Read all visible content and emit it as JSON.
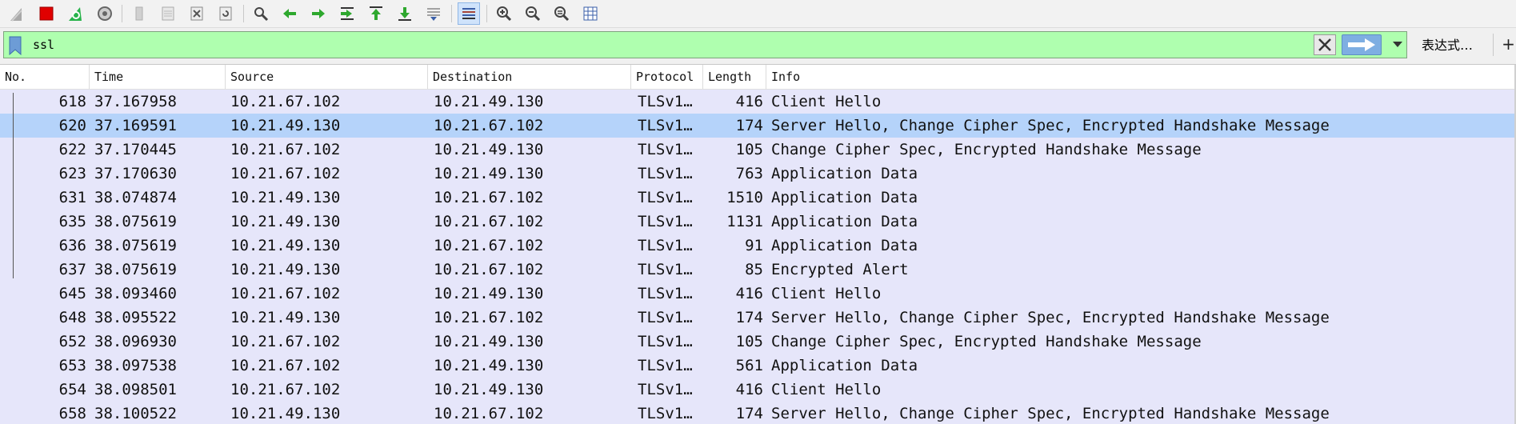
{
  "toolbar": {
    "buttons": [
      {
        "name": "start-capture-icon",
        "color": "#9a9a9a"
      },
      {
        "name": "stop-capture-icon",
        "color": "#e00000"
      },
      {
        "name": "restart-capture-icon",
        "color": "#27b34a"
      },
      {
        "name": "capture-options-icon",
        "color": "#777777"
      },
      {
        "name": "open-file-icon",
        "color": "#bdbdbd"
      },
      {
        "name": "save-file-icon",
        "color": "#bdbdbd"
      },
      {
        "name": "close-file-icon",
        "color": "#8a8a8a"
      },
      {
        "name": "reload-file-icon",
        "color": "#8a8a8a"
      },
      {
        "name": "find-packet-icon",
        "color": "#444444"
      },
      {
        "name": "go-back-icon",
        "color": "#2ea82e"
      },
      {
        "name": "go-forward-icon",
        "color": "#2ea82e"
      },
      {
        "name": "go-to-packet-icon",
        "color": "#2ea82e"
      },
      {
        "name": "go-first-packet-icon",
        "color": "#2ea82e"
      },
      {
        "name": "go-last-packet-icon",
        "color": "#2ea82e"
      },
      {
        "name": "auto-scroll-icon",
        "color": "#3a5fa8"
      },
      {
        "name": "colorize-icon",
        "color": "#3a5fa8"
      },
      {
        "name": "zoom-in-icon",
        "color": "#444444"
      },
      {
        "name": "zoom-out-icon",
        "color": "#444444"
      },
      {
        "name": "normal-size-icon",
        "color": "#444444"
      },
      {
        "name": "resize-columns-icon",
        "color": "#3a5fa8"
      }
    ]
  },
  "filter": {
    "value": "ssl",
    "expression_label": "表达式…",
    "plus_label": "+",
    "bg_color": "#afffaf"
  },
  "columns": [
    "No.",
    "Time",
    "Source",
    "Destination",
    "Protocol",
    "Length",
    "Info"
  ],
  "packets": [
    {
      "no": "618",
      "time": "37.167958",
      "source": "10.21.67.102",
      "destination": "10.21.49.130",
      "protocol": "TLSv1…",
      "length": "416",
      "info": "Client Hello",
      "selected": false
    },
    {
      "no": "620",
      "time": "37.169591",
      "source": "10.21.49.130",
      "destination": "10.21.67.102",
      "protocol": "TLSv1…",
      "length": "174",
      "info": "Server Hello, Change Cipher Spec, Encrypted Handshake Message",
      "selected": true
    },
    {
      "no": "622",
      "time": "37.170445",
      "source": "10.21.67.102",
      "destination": "10.21.49.130",
      "protocol": "TLSv1…",
      "length": "105",
      "info": "Change Cipher Spec, Encrypted Handshake Message",
      "selected": false
    },
    {
      "no": "623",
      "time": "37.170630",
      "source": "10.21.67.102",
      "destination": "10.21.49.130",
      "protocol": "TLSv1…",
      "length": "763",
      "info": "Application Data",
      "selected": false
    },
    {
      "no": "631",
      "time": "38.074874",
      "source": "10.21.49.130",
      "destination": "10.21.67.102",
      "protocol": "TLSv1…",
      "length": "1510",
      "info": "Application Data",
      "selected": false
    },
    {
      "no": "635",
      "time": "38.075619",
      "source": "10.21.49.130",
      "destination": "10.21.67.102",
      "protocol": "TLSv1…",
      "length": "1131",
      "info": "Application Data",
      "selected": false
    },
    {
      "no": "636",
      "time": "38.075619",
      "source": "10.21.49.130",
      "destination": "10.21.67.102",
      "protocol": "TLSv1…",
      "length": "91",
      "info": "Application Data",
      "selected": false
    },
    {
      "no": "637",
      "time": "38.075619",
      "source": "10.21.49.130",
      "destination": "10.21.67.102",
      "protocol": "TLSv1…",
      "length": "85",
      "info": "Encrypted Alert",
      "selected": false
    },
    {
      "no": "645",
      "time": "38.093460",
      "source": "10.21.67.102",
      "destination": "10.21.49.130",
      "protocol": "TLSv1…",
      "length": "416",
      "info": "Client Hello",
      "selected": false
    },
    {
      "no": "648",
      "time": "38.095522",
      "source": "10.21.49.130",
      "destination": "10.21.67.102",
      "protocol": "TLSv1…",
      "length": "174",
      "info": "Server Hello, Change Cipher Spec, Encrypted Handshake Message",
      "selected": false
    },
    {
      "no": "652",
      "time": "38.096930",
      "source": "10.21.67.102",
      "destination": "10.21.49.130",
      "protocol": "TLSv1…",
      "length": "105",
      "info": "Change Cipher Spec, Encrypted Handshake Message",
      "selected": false
    },
    {
      "no": "653",
      "time": "38.097538",
      "source": "10.21.67.102",
      "destination": "10.21.49.130",
      "protocol": "TLSv1…",
      "length": "561",
      "info": "Application Data",
      "selected": false
    },
    {
      "no": "654",
      "time": "38.098501",
      "source": "10.21.67.102",
      "destination": "10.21.49.130",
      "protocol": "TLSv1…",
      "length": "416",
      "info": "Client Hello",
      "selected": false
    },
    {
      "no": "658",
      "time": "38.100522",
      "source": "10.21.49.130",
      "destination": "10.21.67.102",
      "protocol": "TLSv1…",
      "length": "174",
      "info": "Server Hello, Change Cipher Spec, Encrypted Handshake Message",
      "selected": false
    }
  ],
  "colors": {
    "row_bg": "#e6e6fa",
    "selected_bg": "#b5d3fa"
  }
}
